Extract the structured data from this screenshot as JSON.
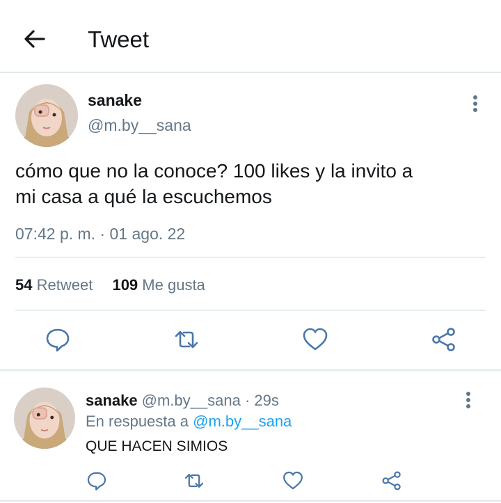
{
  "header": {
    "title": "Tweet"
  },
  "tweet": {
    "author_name": "sanake",
    "author_handle": "@m.by__sana",
    "text_line1": "cómo que no la conoce? 100 likes y la invito a",
    "text_line2": "mi casa a qué la escuchemos",
    "timestamp": "07:42 p. m. · 01 ago. 22",
    "retweet_count": "54",
    "retweet_label": "Retweet",
    "like_count": "109",
    "like_label": "Me gusta"
  },
  "reply": {
    "author_name": "sanake",
    "author_handle": "@m.by__sana",
    "age": "· 29s",
    "in_reply_prefix": "En respuesta a",
    "in_reply_handle": "@m.by__sana",
    "text": "QUE HACEN SIMIOS"
  },
  "colors": {
    "text_primary": "#14171a",
    "text_secondary": "#657786",
    "link": "#1da1f2",
    "icon": "#4a76a8",
    "divider": "#e1e8ed"
  },
  "icons": {
    "back": "arrow-left-icon",
    "more": "more-vertical-icon",
    "reply": "comment-icon",
    "retweet": "retweet-icon",
    "like": "heart-icon",
    "share": "share-icon"
  }
}
